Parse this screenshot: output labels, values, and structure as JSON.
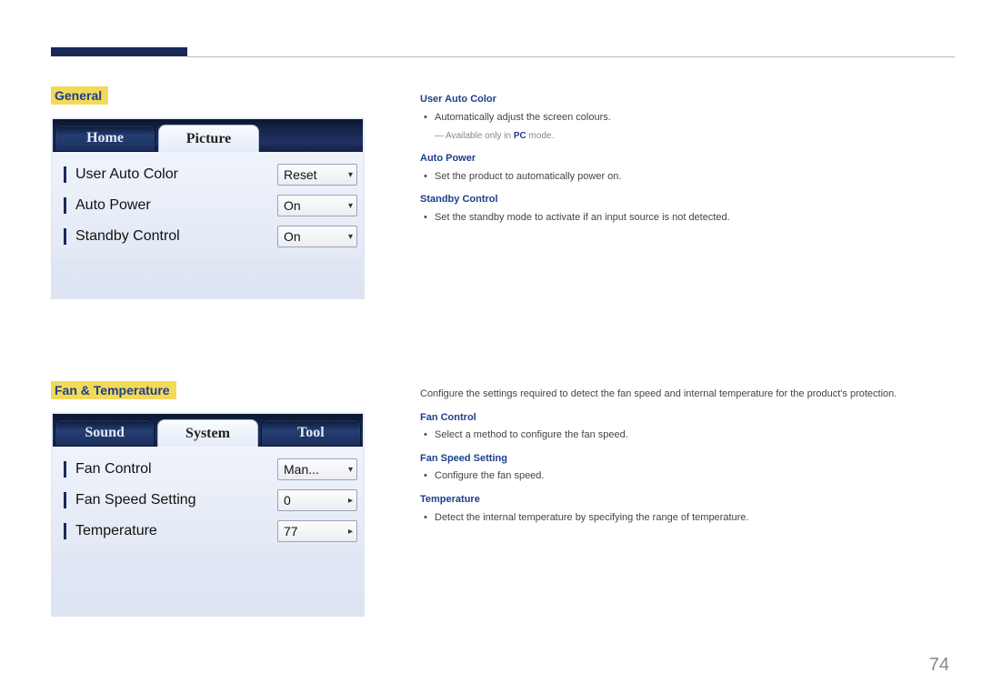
{
  "page_number": "74",
  "section1": {
    "title": "General",
    "panel": {
      "tabs": [
        {
          "label": "Home",
          "active": false
        },
        {
          "label": "Picture",
          "active": true
        }
      ],
      "rows": [
        {
          "label": "User Auto Color",
          "value": "Reset",
          "arrow": "▾"
        },
        {
          "label": "Auto Power",
          "value": "On",
          "arrow": "▾"
        },
        {
          "label": "Standby Control",
          "value": "On",
          "arrow": "▾"
        }
      ]
    },
    "descriptions": [
      {
        "heading": "User Auto Color",
        "bullets": [
          "Automatically adjust the screen colours."
        ],
        "note_prefix": "―",
        "note_text_before": "Available only in ",
        "note_pc": "PC",
        "note_text_after": " mode."
      },
      {
        "heading": "Auto Power",
        "bullets": [
          "Set the product to automatically power on."
        ]
      },
      {
        "heading": "Standby Control",
        "bullets": [
          "Set the standby mode to activate if an input source is not detected."
        ]
      }
    ]
  },
  "section2": {
    "title": "Fan & Temperature",
    "intro": "Configure the settings required to detect the fan speed and internal temperature for the product's protection.",
    "panel": {
      "tabs": [
        {
          "label": "Sound",
          "active": false
        },
        {
          "label": "System",
          "active": true
        },
        {
          "label": "Tool",
          "active": false
        }
      ],
      "rows": [
        {
          "label": "Fan Control",
          "value": "Man...",
          "arrow": "▾"
        },
        {
          "label": "Fan Speed Setting",
          "value": "0",
          "arrow": "▸"
        },
        {
          "label": "Temperature",
          "value": "77",
          "arrow": "▸"
        }
      ]
    },
    "descriptions": [
      {
        "heading": "Fan Control",
        "bullets": [
          "Select a method to configure the fan speed."
        ]
      },
      {
        "heading": "Fan Speed Setting",
        "bullets": [
          "Configure the fan speed."
        ]
      },
      {
        "heading": "Temperature",
        "bullets": [
          "Detect the internal temperature by specifying the range of temperature."
        ]
      }
    ]
  }
}
